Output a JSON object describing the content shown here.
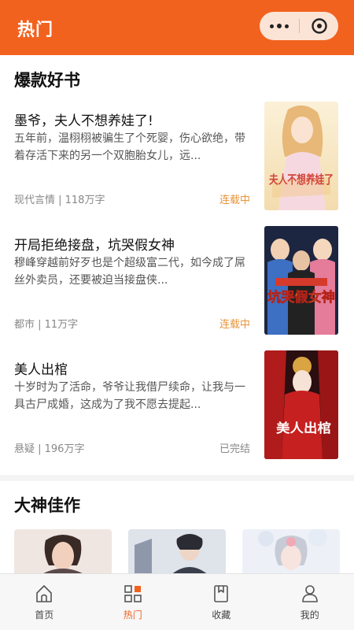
{
  "header": {
    "title": "热门",
    "accent_color": "#f2621f"
  },
  "sections": {
    "hot": {
      "title": "爆款好书"
    },
    "masters": {
      "title": "大神佳作"
    }
  },
  "books": [
    {
      "title": "墨爷，夫人不想养娃了!",
      "description": "五年前，温栩栩被骗生了个死婴，伤心欲绝，带着存活下来的另一个双胞胎女儿，远...",
      "meta": "现代言情 | 118万字",
      "status": "连载中",
      "cover_caption": "夫人不想养娃了"
    },
    {
      "title": "开局拒绝接盘，坑哭假女神",
      "description": "穆峰穿越前好歹也是个超级富二代，如今成了屌丝外卖员，还要被迫当接盘侠...",
      "meta": "都市 | 11万字",
      "status": "连载中",
      "cover_caption": "坑哭假女神"
    },
    {
      "title": "美人出棺",
      "description": "十岁时为了活命，爷爷让我借尸续命，让我与一具古尸成婚，这成为了我不愿去提起...",
      "meta": "悬疑 | 196万字",
      "status": "已完结",
      "cover_caption": "美人出棺"
    }
  ],
  "tabs": [
    {
      "label": "首页",
      "icon": "home-icon"
    },
    {
      "label": "热门",
      "icon": "hot-icon"
    },
    {
      "label": "收藏",
      "icon": "bookmark-icon"
    },
    {
      "label": "我的",
      "icon": "user-icon"
    }
  ]
}
